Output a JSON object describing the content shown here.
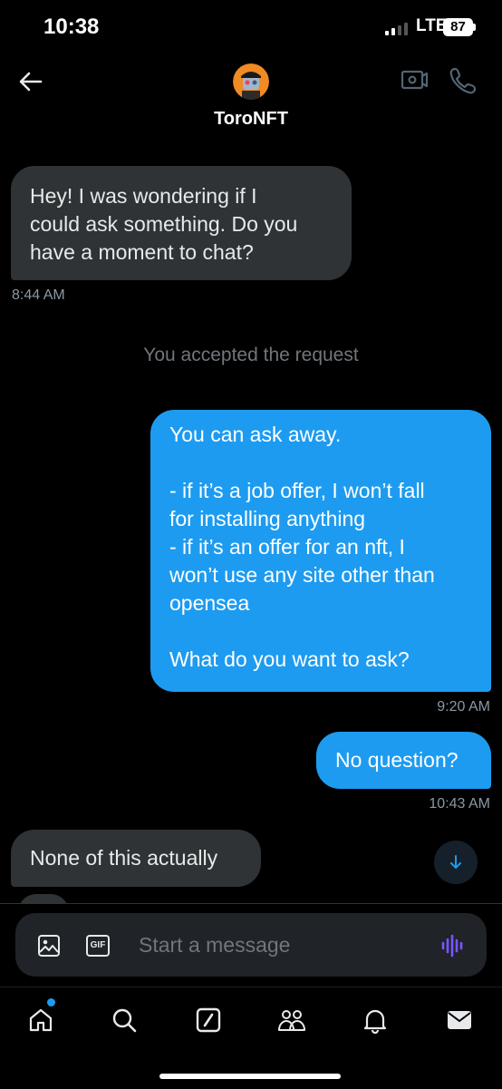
{
  "status_bar": {
    "time": "10:38",
    "network": "LTE",
    "battery": "87"
  },
  "header": {
    "contact_name": "ToroNFT"
  },
  "messages": [
    {
      "direction": "in",
      "lines": [
        "Hey! I was wondering if I",
        "could ask something. Do you",
        "have a moment to chat?"
      ],
      "time": "8:44 AM"
    },
    {
      "direction": "system",
      "text": "You accepted the request"
    },
    {
      "direction": "out",
      "lines": [
        "You can ask away.",
        "",
        "- if it’s a job offer, I won’t fall",
        "for installing anything",
        "- if it’s an offer for an nft, I",
        "won’t use any site other than",
        "opensea",
        "",
        "What do you want to ask?"
      ],
      "time": "9:20 AM"
    },
    {
      "direction": "out",
      "lines": [
        "No question?"
      ],
      "time": "10:43 AM"
    },
    {
      "direction": "in",
      "lines": [
        "None of this actually"
      ]
    }
  ],
  "composer": {
    "placeholder": "Start a message",
    "gif_label": "GIF"
  },
  "icons": {
    "back": "back-arrow-icon",
    "video": "video-camera-icon",
    "call": "phone-icon",
    "image": "image-icon",
    "gif": "gif-icon",
    "voice": "voice-wave-icon",
    "scroll": "arrow-down-icon",
    "home": "home-icon",
    "search": "search-icon",
    "compose": "compose-icon",
    "communities": "communities-icon",
    "notifications": "bell-icon",
    "messages": "mail-icon"
  },
  "colors": {
    "accent": "#1d9bf0",
    "incoming_bubble": "#2f3336",
    "background": "#000000",
    "voice_icon": "#7856ff"
  }
}
